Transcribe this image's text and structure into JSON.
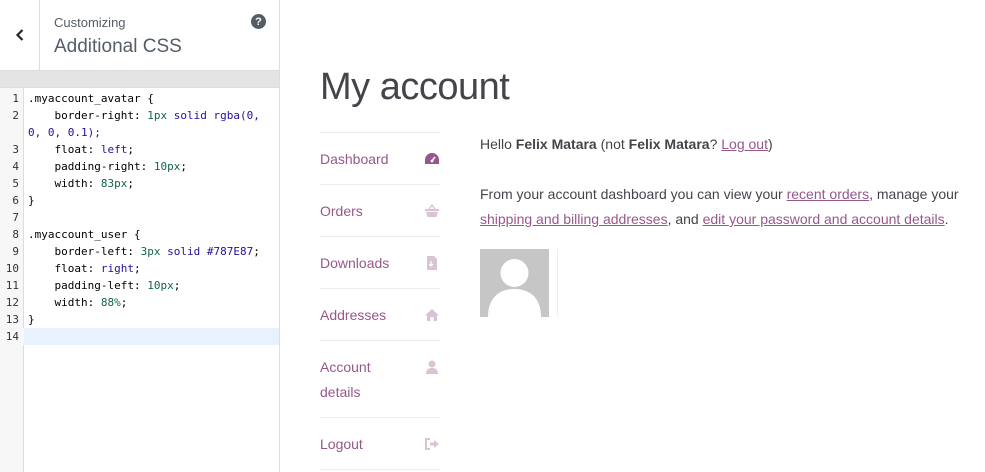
{
  "customizer": {
    "subtitle": "Customizing",
    "title": "Additional CSS",
    "back_icon": "chevron-left-icon",
    "help_symbol": "?",
    "code_lines": [
      {
        "num": "1",
        "tokens": [
          {
            "t": ".myaccount_avatar {",
            "c": "sel"
          }
        ]
      },
      {
        "num": "2",
        "tokens": [
          {
            "t": "    border-right: ",
            "c": "prop"
          },
          {
            "t": "1px",
            "c": "num"
          },
          {
            "t": " ",
            "c": "prop"
          },
          {
            "t": "solid",
            "c": "kw"
          },
          {
            "t": " ",
            "c": "prop"
          },
          {
            "t": "rgba(0,",
            "c": "kw"
          }
        ]
      },
      {
        "num": "",
        "tokens": [
          {
            "t": "0, 0, 0.1);",
            "c": "kw"
          }
        ]
      },
      {
        "num": "3",
        "tokens": [
          {
            "t": "    float: ",
            "c": "prop"
          },
          {
            "t": "left",
            "c": "kw"
          },
          {
            "t": ";",
            "c": "prop"
          }
        ]
      },
      {
        "num": "4",
        "tokens": [
          {
            "t": "    padding-right: ",
            "c": "prop"
          },
          {
            "t": "10px",
            "c": "num"
          },
          {
            "t": ";",
            "c": "prop"
          }
        ]
      },
      {
        "num": "5",
        "tokens": [
          {
            "t": "    width: ",
            "c": "prop"
          },
          {
            "t": "83px",
            "c": "num"
          },
          {
            "t": ";",
            "c": "prop"
          }
        ]
      },
      {
        "num": "6",
        "tokens": [
          {
            "t": "}",
            "c": "sel"
          }
        ]
      },
      {
        "num": "7",
        "tokens": [
          {
            "t": "",
            "c": "sel"
          }
        ]
      },
      {
        "num": "8",
        "tokens": [
          {
            "t": ".myaccount_user {",
            "c": "sel"
          }
        ]
      },
      {
        "num": "9",
        "tokens": [
          {
            "t": "    border-left: ",
            "c": "prop"
          },
          {
            "t": "3px",
            "c": "num"
          },
          {
            "t": " ",
            "c": "prop"
          },
          {
            "t": "solid",
            "c": "kw"
          },
          {
            "t": " ",
            "c": "prop"
          },
          {
            "t": "#787E87",
            "c": "kw"
          },
          {
            "t": ";",
            "c": "prop"
          }
        ]
      },
      {
        "num": "10",
        "tokens": [
          {
            "t": "    float: ",
            "c": "prop"
          },
          {
            "t": "right",
            "c": "kw"
          },
          {
            "t": ";",
            "c": "prop"
          }
        ]
      },
      {
        "num": "11",
        "tokens": [
          {
            "t": "    padding-left: ",
            "c": "prop"
          },
          {
            "t": "10px",
            "c": "num"
          },
          {
            "t": ";",
            "c": "prop"
          }
        ]
      },
      {
        "num": "12",
        "tokens": [
          {
            "t": "    width: ",
            "c": "prop"
          },
          {
            "t": "88%",
            "c": "num"
          },
          {
            "t": ";",
            "c": "prop"
          }
        ]
      },
      {
        "num": "13",
        "tokens": [
          {
            "t": "}",
            "c": "sel"
          }
        ]
      },
      {
        "num": "14",
        "tokens": [
          {
            "t": "",
            "c": "sel"
          }
        ]
      }
    ],
    "active_line": "14"
  },
  "page": {
    "title": "My account",
    "nav": [
      {
        "label": "Dashboard",
        "icon": "dashboard-icon",
        "active": true
      },
      {
        "label": "Orders",
        "icon": "basket-icon",
        "active": false
      },
      {
        "label": "Downloads",
        "icon": "file-icon",
        "active": false
      },
      {
        "label": "Addresses",
        "icon": "home-icon",
        "active": false
      },
      {
        "label": "Account details",
        "icon": "user-icon",
        "active": false
      },
      {
        "label": "Logout",
        "icon": "sign-out-icon",
        "active": false
      }
    ],
    "hello": {
      "prefix": "Hello ",
      "name": "Felix Matara",
      "mid": " (not ",
      "name2": "Felix Matara",
      "q": "? ",
      "logout": "Log out",
      "suffix": ")"
    },
    "dash": {
      "p1": "From your account dashboard you can view your ",
      "link1": "recent orders",
      "p2": ", manage your ",
      "link2": "shipping and billing addresses",
      "p3": ", and ",
      "link3": "edit your password and account details",
      "p4": "."
    }
  },
  "colors": {
    "link": "#96588a",
    "icon_active": "#96588a",
    "icon_inactive": "#d9c4d6"
  }
}
